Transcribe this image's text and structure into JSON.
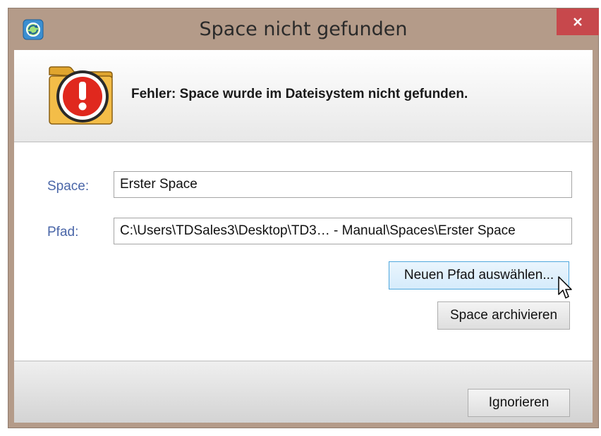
{
  "window": {
    "title": "Space nicht gefunden",
    "close_label": "✕",
    "app_icon": "refresh-app-icon",
    "close_color": "#c7484c"
  },
  "header": {
    "icon": "folder-error-icon",
    "message": "Fehler: Space wurde im Dateisystem nicht gefunden."
  },
  "form": {
    "space_label": "Space:",
    "space_value": "Erster Space",
    "path_label": "Pfad:",
    "path_value": "C:\\Users\\TDSales3\\Desktop\\TD3… - Manual\\Spaces\\Erster Space"
  },
  "actions": {
    "new_path_label": "Neuen Pfad auswählen...",
    "archive_label": "Space archivieren"
  },
  "footer": {
    "ignore_label": "Ignorieren"
  },
  "colors": {
    "label": "#4a66a8",
    "frame": "#b49b89",
    "hover_border": "#4fa7dd"
  }
}
